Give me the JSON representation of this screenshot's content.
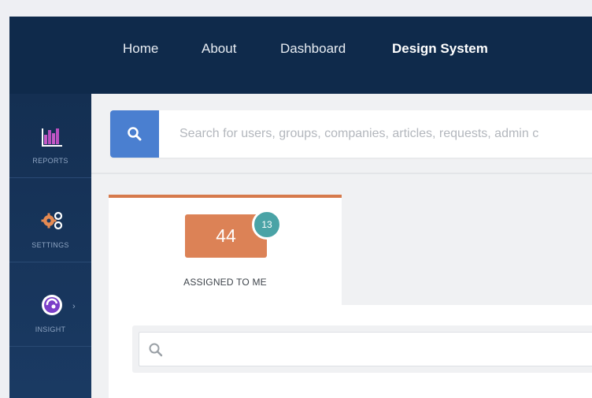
{
  "topnav": {
    "items": [
      {
        "label": "Home"
      },
      {
        "label": "About"
      },
      {
        "label": "Dashboard"
      },
      {
        "label": "Design System",
        "active": true
      }
    ],
    "background_color": "#0f2a4b"
  },
  "sidebar": {
    "items": [
      {
        "label": "REPORTS",
        "icon": "bar-chart-icon"
      },
      {
        "label": "SETTINGS",
        "icon": "gears-icon"
      },
      {
        "label": "INSIGHT",
        "icon": "insight-icon"
      }
    ]
  },
  "search": {
    "icon": "search-icon",
    "placeholder": "Search for users, groups, companies, articles, requests, admin c",
    "value": ""
  },
  "tab": {
    "count": "44",
    "badge": "13",
    "label": "ASSIGNED TO ME",
    "accent_color": "#dc8256",
    "badge_color": "#4aa3a6"
  },
  "filter": {
    "icon": "search-icon",
    "placeholder": "",
    "value": ""
  },
  "colors": {
    "primary_button": "#4a7fd0",
    "reports_icon": "#b94fbf",
    "settings_icon": "#e58a52"
  }
}
